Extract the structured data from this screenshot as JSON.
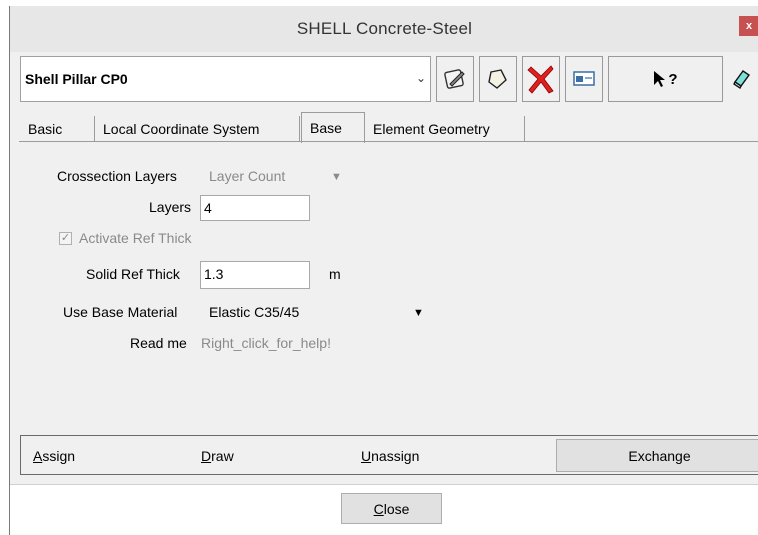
{
  "window": {
    "title": "SHELL Concrete-Steel",
    "close_glyph": "x"
  },
  "selector": {
    "value": "Shell Pillar CP0",
    "arrow": "⌄"
  },
  "toolbar": {
    "icons": [
      "edit-icon",
      "new-icon",
      "delete-icon",
      "window-icon",
      "help-pointer-icon",
      "eraser-icon"
    ],
    "help_text": "?"
  },
  "tabs": [
    {
      "label": "Basic"
    },
    {
      "label": "Local Coordinate System"
    },
    {
      "label": "Base"
    },
    {
      "label": "Element Geometry"
    }
  ],
  "form": {
    "crossection_label": "Crossection Layers",
    "crossection_value": "Layer Count",
    "layers_label": "Layers",
    "layers_value": "4",
    "activate_label": "Activate Ref Thick",
    "solid_label": "Solid Ref Thick",
    "solid_value": "1.3",
    "solid_unit": "m",
    "material_label": "Use Base Material",
    "material_value": "Elastic C35/45",
    "readme_label": "Read me",
    "readme_value": "Right_click_for_help!"
  },
  "actions": {
    "assign_first": "A",
    "assign_rest": "ssign",
    "draw_first": "D",
    "draw_rest": "raw",
    "unassign_first": "U",
    "unassign_rest": "nassign",
    "exchange": "Exchange"
  },
  "footer": {
    "close_first": "C",
    "close_rest": "lose"
  }
}
